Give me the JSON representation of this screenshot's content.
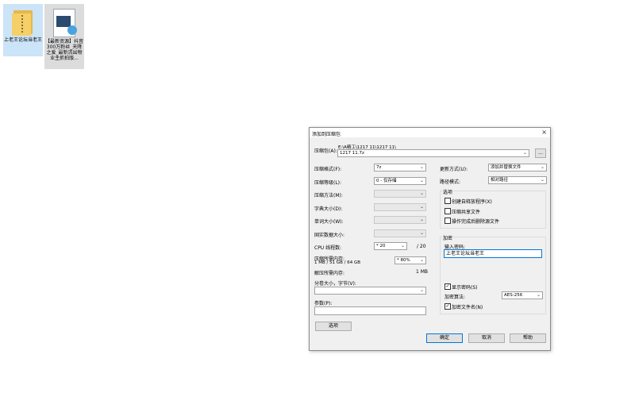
{
  "desktop": {
    "icons": [
      {
        "label": "上老王论坛当老王"
      },
      {
        "label": "【最新资源】抖音300万粉丝_天降之爱_最新流出物业主抓拍版..."
      }
    ]
  },
  "dialog": {
    "title": "添加到压缩包",
    "close_symbol": "×",
    "archive": {
      "label": "压缩包(A):",
      "path": "E:\\A精工\\1217 11\\1217 11\\",
      "value": "1217 11.7z",
      "browse_label": "..."
    },
    "left_fields": [
      {
        "label": "压缩格式(F):",
        "value": "7z",
        "disabled": false
      },
      {
        "label": "压缩等级(L):",
        "value": "0 - 仅存储",
        "disabled": false
      },
      {
        "label": "压缩方法(M):",
        "value": "",
        "disabled": true
      },
      {
        "label": "字典大小(D):",
        "value": "",
        "disabled": true
      },
      {
        "label": "单词大小(W):",
        "value": "",
        "disabled": true
      },
      {
        "label": "固实数据大小:",
        "value": "",
        "disabled": true
      }
    ],
    "cpu": {
      "label": "CPU 线程数:",
      "value": "* 20",
      "max": "/ 20"
    },
    "memory": {
      "label": "压缩所需内存:",
      "detail": "1 MB / 51 GB / 64 GB",
      "value": "* 80%"
    },
    "decompress_memory": {
      "label": "解压所需内存:",
      "value": "1 MB"
    },
    "split": {
      "label": "分卷大小，字节(V):",
      "value": ""
    },
    "params": {
      "label": "参数(P):",
      "value": ""
    },
    "options_button": "选项",
    "update_mode": {
      "label": "更新方式(U):",
      "value": "添加并替换文件"
    },
    "path_mode": {
      "label": "路径模式:",
      "value": "相对路径"
    },
    "options_group": {
      "title": "选项",
      "items": [
        {
          "label": "创建自释放程序(X)",
          "checked": false
        },
        {
          "label": "压缩共享文件",
          "checked": false
        },
        {
          "label": "操作完成后删除源文件",
          "checked": false
        }
      ]
    },
    "encryption": {
      "title": "加密",
      "password_label": "输入密码:",
      "password_value": "上老王论坛当老王",
      "show_password": {
        "label": "显示密码(S)",
        "checked": true
      },
      "method_label": "加密算法:",
      "method_value": "AES-256",
      "encrypt_names": {
        "label": "加密文件名(N)",
        "checked": true
      }
    },
    "buttons": {
      "ok": "确定",
      "cancel": "取消",
      "help": "帮助"
    },
    "check_symbol": "✓",
    "arrow_symbol": "⌄"
  }
}
